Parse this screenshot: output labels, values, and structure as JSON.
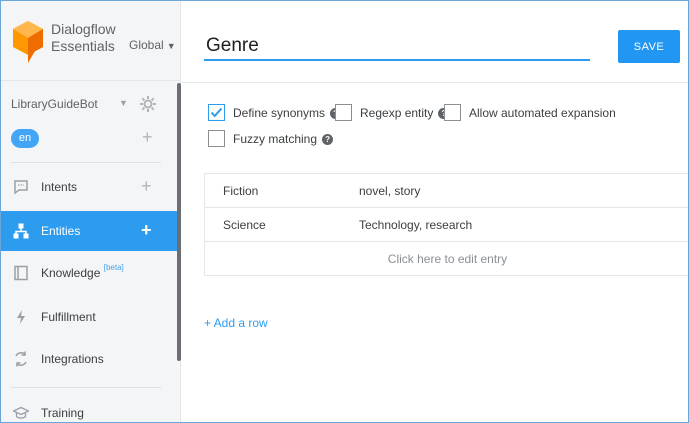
{
  "brand": {
    "line1": "Dialogflow",
    "line2": "Essentials",
    "scope": "Global",
    "logo_color": "#ff9800"
  },
  "agent": {
    "name": "LibraryGuideBot",
    "language": "en"
  },
  "nav": [
    {
      "label": "Intents",
      "icon": "intents-icon",
      "has_plus": true,
      "active": false
    },
    {
      "label": "Entities",
      "icon": "entities-icon",
      "has_plus": true,
      "active": true
    },
    {
      "label": "Knowledge",
      "beta": "[beta]",
      "icon": "knowledge-icon",
      "has_plus": false,
      "active": false
    },
    {
      "label": "Fulfillment",
      "icon": "fulfillment-icon",
      "has_plus": false,
      "active": false
    },
    {
      "label": "Integrations",
      "icon": "integrations-icon",
      "has_plus": false,
      "active": false
    },
    {
      "label": "Training",
      "icon": "training-icon",
      "has_plus": false,
      "active": false
    }
  ],
  "entity": {
    "name": "Genre",
    "save_label": "SAVE"
  },
  "options": {
    "define_synonyms": {
      "label": "Define synonyms",
      "checked": true
    },
    "regexp_entity": {
      "label": "Regexp entity",
      "checked": false
    },
    "automated_expansion": {
      "label": "Allow automated expansion",
      "checked": false
    },
    "fuzzy_matching": {
      "label": "Fuzzy matching",
      "checked": false
    }
  },
  "entries": [
    {
      "value": "Fiction",
      "synonyms": "novel, story"
    },
    {
      "value": "Science",
      "synonyms": "Technology, research"
    }
  ],
  "edit_entry_label": "Click here to edit entry",
  "add_row_label": "+ Add a row",
  "colors": {
    "accent": "#2196f3",
    "active_nav": "#2d9cef",
    "sidebar_bg": "#f3f5f7"
  }
}
